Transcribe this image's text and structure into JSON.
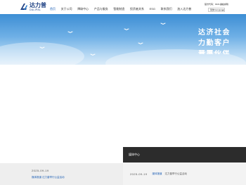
{
  "header": {
    "logo": {
      "name_cn": "达力普",
      "name_en": "DALIPAL",
      "brand_color": "#1c3f82"
    },
    "nav": [
      {
        "label": "首页",
        "active": true
      },
      {
        "label": "关于公司"
      },
      {
        "label": "降碳中心"
      },
      {
        "label": "产品与服务"
      },
      {
        "label": "智能制造"
      },
      {
        "label": "投资者关系"
      },
      {
        "label": "ESG"
      },
      {
        "label": "联系我们"
      },
      {
        "label": "加入达力普"
      }
    ],
    "stock": "股份代码：9021.HK",
    "corp_mail": "企业邮箱",
    "language": {
      "selected": "简体/Language"
    }
  },
  "hero": {
    "slogan_lines": [
      "达济社会",
      "力勤客户",
      "普惠伙伴"
    ],
    "sky_colors": [
      "#3d8ed4",
      "#dcecf9"
    ]
  },
  "news_box": {
    "title": "媒体中心",
    "item": {
      "date": "2025-09-19",
      "tag": "媒体报道",
      "text": "达力普举行公益活动"
    }
  },
  "left_news": {
    "date": "2025-09-19",
    "text": "媒体报道 达力普举行公益活动"
  },
  "accent_color": "#1c5fb5"
}
